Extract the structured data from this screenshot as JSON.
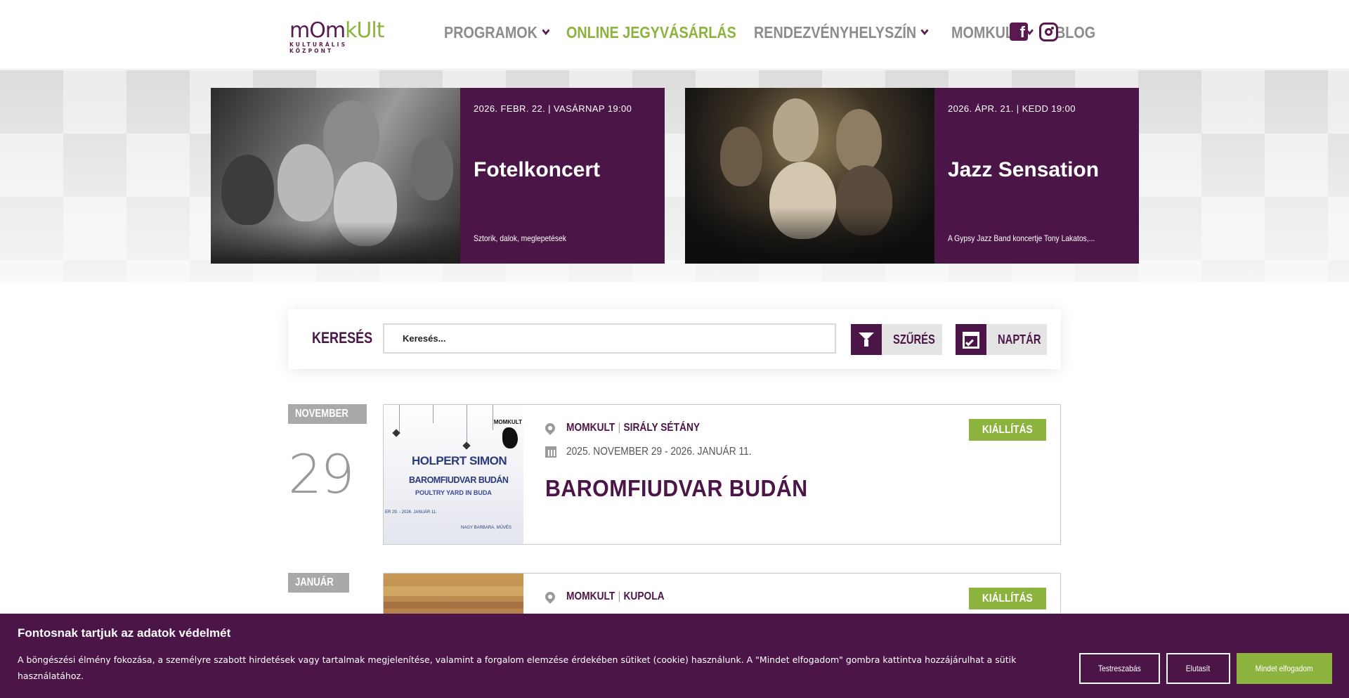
{
  "logo": {
    "main_a": "mOm",
    "main_b": "kUlt",
    "sub": "KULTURÁLIS KÖZPONT"
  },
  "nav": {
    "items": [
      {
        "label": "PROGRAMOK",
        "has_dropdown": true
      },
      {
        "label": "ONLINE JEGYVÁSÁRLÁS",
        "has_dropdown": false
      },
      {
        "label": "RENDEZVÉNYHELYSZÍN",
        "has_dropdown": true
      },
      {
        "label": "MOMKULT",
        "has_dropdown": true
      },
      {
        "label": "BLOG",
        "has_dropdown": false
      }
    ],
    "social": [
      {
        "icon": "facebook-icon"
      },
      {
        "icon": "instagram-icon"
      }
    ]
  },
  "featured": [
    {
      "date": "2026. FEBR. 22. | VASÁRNAP 19:00",
      "title": "Fotelkoncert",
      "subtitle": "Sztorik, dalok, meglepetések"
    },
    {
      "date": "2026. ÁPR. 21. | KEDD 19:00",
      "title": "Jazz Sensation",
      "subtitle": "A Gypsy Jazz Band koncertje Tony Lakatos,..."
    }
  ],
  "search": {
    "label": "KERESÉS",
    "placeholder": "Keresés...",
    "filter_label": "SZŰRÉS",
    "calendar_label": "NAPTÁR"
  },
  "events": [
    {
      "month": "NOVEMBER",
      "day": "29",
      "venue": "MOMKULT",
      "room": "SIRÁLY SÉTÁNY",
      "dates": "2025. NOVEMBER 29 - 2026. JANUÁR 11.",
      "title": "BAROMFIUDVAR BUDÁN",
      "category": "KIÁLLÍTÁS",
      "poster": {
        "brand": "MOMKULT",
        "title": "HOLPERT SIMON",
        "subtitle": "BAROMFIUDVAR BUDÁN",
        "subtitle_en": "POULTRY YARD IN BUDA",
        "footer": "ER 29. - 2026. JANUÁR 11.",
        "footer2": "NAGY BARBARA, MŰVÉS"
      }
    },
    {
      "month": "JANUÁR",
      "venue": "MOMKULT",
      "room": "KUPOLA",
      "category": "KIÁLLÍTÁS"
    }
  ],
  "cookie": {
    "title": "Fontosnak tartjuk az adatok védelmét",
    "text": "A böngészési élmény fokozása, a személyre szabott hirdetések vagy tartalmak megjelenítése, valamint a forgalom elemzése érdekében sütiket (cookie) használunk. A \"Mindet elfogadom\" gombra kattintva hozzájárulhat a sütik használatához.",
    "btn_settings": "Testreszabás",
    "btn_reject": "Elutasít",
    "btn_accept": "Mindet elfogadom"
  },
  "colors": {
    "brand_purple": "#4b1647",
    "accent_green": "#8cb33e",
    "nav_gray": "#8c8c8c"
  }
}
